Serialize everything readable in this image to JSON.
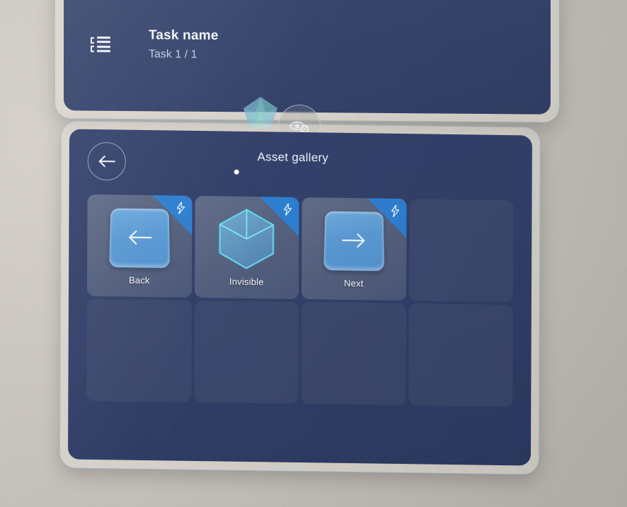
{
  "scene": {
    "environment": "mixed-reality wall backdrop",
    "colors": {
      "wall": "#cdc8c0",
      "panel_navy": "#33416a",
      "panel_frame": "#e2ded7",
      "accent_blue": "#2f7fd1",
      "plaque_blue": "#5b9ad4",
      "wire_cyan": "#63d5e8",
      "text_primary": "#f2f5f9",
      "text_secondary": "#c2cbdd",
      "glow_outline": "#96c8e1"
    }
  },
  "task_panel": {
    "icon": "task-list-icon",
    "title": "Task name",
    "subtitle": "Task 1 / 1"
  },
  "hologram": {
    "icon": "icosahedron-hologram"
  },
  "visibility_toggle": {
    "icon": "eye-hidden-icon",
    "label": "Toggle visibility"
  },
  "gallery_panel": {
    "title": "Asset gallery",
    "back_button": {
      "icon": "arrow-left-icon",
      "label": "Back"
    },
    "pagination": {
      "pages": 1,
      "active_page": 1,
      "dots": [
        "•"
      ]
    },
    "grid": {
      "columns": 4,
      "rows": 2,
      "cells": [
        {
          "label": "Back",
          "visual": "plaque-arrow-left",
          "badge": "lightning-bolt-icon",
          "filled": true
        },
        {
          "label": "Invisible",
          "visual": "wireframe-cube",
          "badge": "lightning-bolt-icon",
          "filled": true
        },
        {
          "label": "Next",
          "visual": "plaque-arrow-right",
          "badge": "lightning-bolt-icon",
          "filled": true
        },
        {
          "label": "",
          "visual": "",
          "badge": "",
          "filled": false
        },
        {
          "label": "",
          "visual": "",
          "badge": "",
          "filled": false
        },
        {
          "label": "",
          "visual": "",
          "badge": "",
          "filled": false
        },
        {
          "label": "",
          "visual": "",
          "badge": "",
          "filled": false
        },
        {
          "label": "",
          "visual": "",
          "badge": "",
          "filled": false
        }
      ]
    }
  }
}
